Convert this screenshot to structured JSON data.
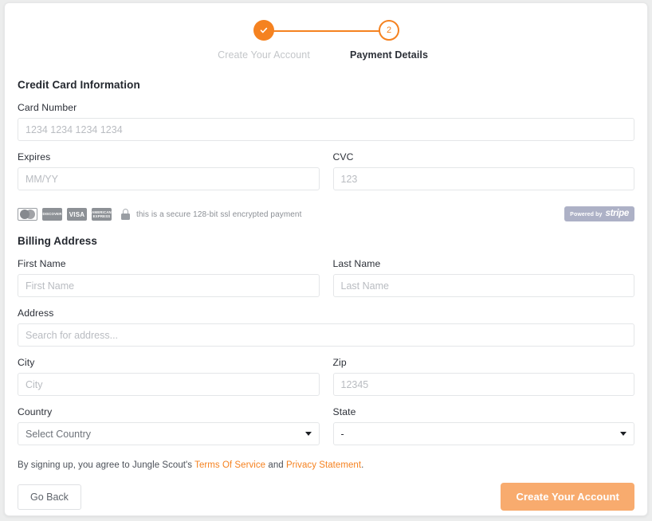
{
  "stepper": {
    "steps": [
      {
        "label": "Create Your Account",
        "marker": "✓",
        "state": "completed"
      },
      {
        "label": "Payment Details",
        "marker": "2",
        "state": "current"
      }
    ]
  },
  "credit_card": {
    "section_title": "Credit Card Information",
    "card_number": {
      "label": "Card Number",
      "value": "",
      "placeholder": "1234 1234 1234 1234"
    },
    "expires": {
      "label": "Expires",
      "value": "",
      "placeholder": "MM/YY"
    },
    "cvc": {
      "label": "CVC",
      "value": "",
      "placeholder": "123"
    }
  },
  "secure": {
    "text": "this is a secure 128-bit ssl encrypted payment",
    "card_brands": [
      "mastercard",
      "discover",
      "visa",
      "american express"
    ],
    "brand_labels": {
      "discover": "DISCOVER",
      "visa": "VISA",
      "amex": "AMERICAN EXPRESS"
    },
    "stripe_prefix": "Powered by",
    "stripe_name": "stripe"
  },
  "billing": {
    "section_title": "Billing Address",
    "first_name": {
      "label": "First Name",
      "value": "",
      "placeholder": "First Name"
    },
    "last_name": {
      "label": "Last Name",
      "value": "",
      "placeholder": "Last Name"
    },
    "address": {
      "label": "Address",
      "value": "",
      "placeholder": "Search for address..."
    },
    "city": {
      "label": "City",
      "value": "",
      "placeholder": "City"
    },
    "zip": {
      "label": "Zip",
      "value": "",
      "placeholder": "12345"
    },
    "country": {
      "label": "Country",
      "selected": "Select Country"
    },
    "state": {
      "label": "State",
      "selected": "-"
    }
  },
  "terms": {
    "prefix": "By signing up, you agree to Jungle Scout's ",
    "tos_link": "Terms Of Service",
    "middle": " and ",
    "privacy_link": "Privacy Statement",
    "suffix": "."
  },
  "footer": {
    "back_label": "Go Back",
    "submit_label": "Create Your Account"
  },
  "colors": {
    "accent": "#f58220",
    "accent_disabled": "#f8ab6e",
    "link": "#f58220",
    "text": "#2c3038",
    "muted": "#b9bcc1",
    "stripe_badge": "#adb1c6"
  }
}
